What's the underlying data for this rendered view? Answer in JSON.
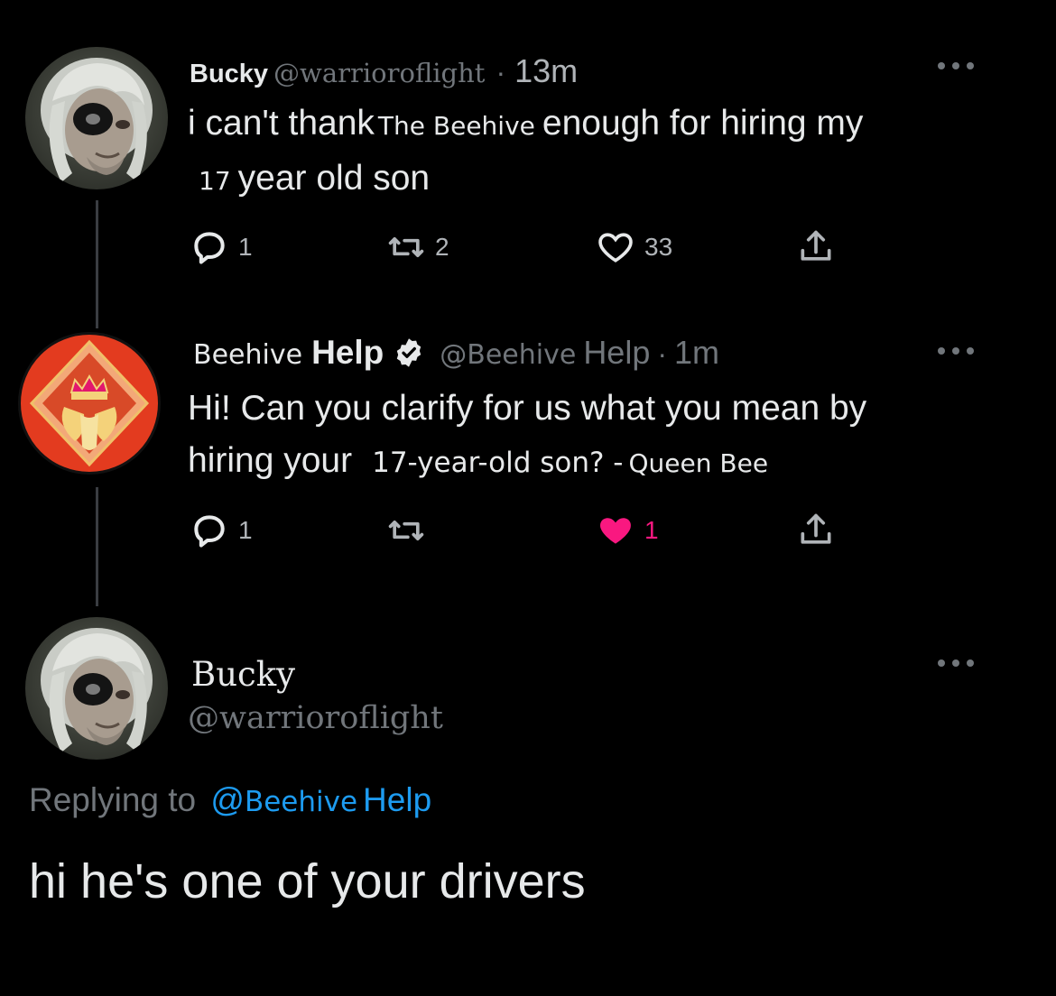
{
  "tweet1": {
    "display_name": "Bucky",
    "handle": "@warrioroflight",
    "separator": "·",
    "time": "13m",
    "text_part1": "i can't thank",
    "text_insert1": "The Beehive",
    "text_part2": "enough for hiring my",
    "text_insert2": "17",
    "text_part3": "year old son",
    "reply_count": "1",
    "retweet_count": "2",
    "like_count": "33"
  },
  "tweet2": {
    "display_name_part1": "Beehive",
    "display_name_part2": "Help",
    "handle_part1": "@Beehive",
    "handle_part2": "Help",
    "separator": "·",
    "time": "1m",
    "text_line1": "Hi! Can you clarify for us what you mean by",
    "text_part1": "hiring your",
    "text_insert1": "17-year-old son? -",
    "text_insert2": "Queen Bee",
    "reply_count": "1",
    "retweet_count": "",
    "like_count": "1",
    "like_color": "#f91880"
  },
  "tweet3": {
    "display_name": "Bucky",
    "handle": "@warrioroflight",
    "replying_to_label": "Replying to",
    "replying_mention_at": "@",
    "replying_mention_part1": "Beehive",
    "replying_mention_part2": "Help",
    "text": "hi he's one of your drivers"
  },
  "colors": {
    "background": "#000000",
    "text": "#e7e9ea",
    "muted": "#71767b",
    "accent": "#1d9bf0",
    "like": "#f91880",
    "beehive_avatar_bg": "#e33b1f"
  },
  "icons": {
    "reply": "reply-icon",
    "retweet": "retweet-icon",
    "like": "heart-icon",
    "share": "share-icon",
    "more": "more-icon",
    "verified": "verified-badge-icon"
  }
}
